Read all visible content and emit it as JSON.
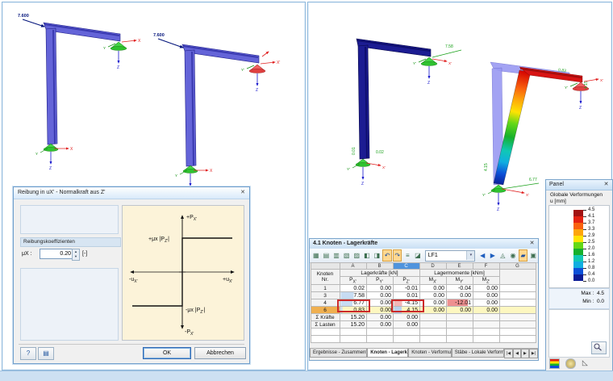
{
  "left_view": {
    "load1": "7.600",
    "load2": "7.600"
  },
  "axes": {
    "x": "X",
    "y": "Y",
    "z": "Z",
    "xp": "X'",
    "yp": "Y'"
  },
  "dialog": {
    "title": "Reibung in uX' - Normalkraft aus Z'",
    "close": "✕",
    "group": "Reibungskoeffizienten",
    "mu_label": "μX :",
    "mu_value": "0.20",
    "mu_unit": "[-]",
    "graph": {
      "top_m": "+P",
      "top_s": "X'",
      "bottom_m": "-P",
      "bottom_s": "X'",
      "right_m": "+u",
      "right_s": "X'",
      "left_m": "-u",
      "left_s": "X'",
      "pos_m": "+μx |P",
      "pos_s": "Z'",
      "pos_e": "|",
      "neg_m": "-μx |P",
      "neg_s": "Z'",
      "neg_e": "|"
    },
    "help": "?",
    "note_icon": "▤",
    "ok": "OK",
    "cancel": "Abbrechen"
  },
  "right_view": {
    "c_top_px": "7.58",
    "c_bot_px": "0.02",
    "c_bot_pz": "0.01",
    "d_top_px": "0.83",
    "d_top_pz": "4.15",
    "d_bot_px": "6.77",
    "d_bot_pz": "4.15"
  },
  "table": {
    "title": "4.1 Knoten - Lagerkräfte",
    "close": "✕",
    "toolbar": [
      {
        "name": "table-graphic-icon",
        "glyph": "▦"
      },
      {
        "name": "view-settings-icon",
        "glyph": "▤"
      },
      {
        "name": "row-filter-icon",
        "glyph": "▥"
      },
      {
        "name": "result-filter-icon",
        "glyph": "▧"
      },
      {
        "name": "selection-icon",
        "glyph": "▨"
      },
      {
        "name": "col-prev-icon",
        "glyph": "◧"
      },
      {
        "name": "col-next-icon",
        "glyph": "◨"
      },
      {
        "name": "undo-icon",
        "glyph": "↶"
      },
      {
        "name": "redo-icon",
        "glyph": "↷"
      },
      {
        "name": "sum-rows-icon",
        "glyph": "≡"
      },
      {
        "name": "result-diagram-icon",
        "glyph": "◪"
      }
    ],
    "loadcase": "LF1",
    "dd": "▾",
    "toolbar2": [
      {
        "name": "prev-case-icon",
        "glyph": "◀"
      },
      {
        "name": "next-case-icon",
        "glyph": "▶"
      },
      {
        "name": "filter-icon",
        "glyph": "◬"
      },
      {
        "name": "relations-icon",
        "glyph": "◉"
      },
      {
        "name": "color-ref-icon",
        "glyph": "▰"
      },
      {
        "name": "excel-export-icon",
        "glyph": "▣"
      }
    ],
    "letters": [
      "A",
      "B",
      "C",
      "D",
      "E",
      "F",
      "G"
    ],
    "hdr": {
      "node1": "Knoten",
      "node2": "Nr.",
      "forces": "Lagerkräfte [kN]",
      "moments": "Lagermomente [kNm]",
      "cols": [
        {
          "m": "P",
          "s": "X'"
        },
        {
          "m": "P",
          "s": "Y'"
        },
        {
          "m": "P",
          "s": "Z'"
        },
        {
          "m": "M",
          "s": "X'"
        },
        {
          "m": "M",
          "s": "Y'"
        },
        {
          "m": "M",
          "s": "Z'"
        }
      ]
    },
    "rows": [
      {
        "id": "1",
        "c": [
          "0.02",
          "0.00",
          "-0.01",
          "0.00",
          "-0.04",
          "0.00"
        ]
      },
      {
        "id": "3",
        "c": [
          "7.58",
          "0.00",
          "0.01",
          "0.00",
          "0.00",
          "0.00"
        ]
      },
      {
        "id": "4",
        "c": [
          "6.77",
          "0.00",
          "-4.15",
          "0.00",
          "-12.01",
          "0.00"
        ]
      },
      {
        "id": "6",
        "c": [
          "0.83",
          "0.00",
          "4.15",
          "0.00",
          "0.00",
          "0.00"
        ]
      },
      {
        "id": "Σ Kräfte",
        "c": [
          "15.20",
          "0.00",
          "0.00",
          "",
          "",
          ""
        ]
      },
      {
        "id": "Σ Lasten",
        "c": [
          "15.20",
          "0.00",
          "0.00",
          "",
          "",
          ""
        ]
      }
    ],
    "tabs": [
      {
        "label": "Ergebnisse - Zusammenfassung"
      },
      {
        "label": "Knoten - Lagerkräfte"
      },
      {
        "label": "Knoten - Verformungen"
      },
      {
        "label": "Stäbe - Lokale Verformungen"
      }
    ],
    "tab_nav": [
      "|◀",
      "◀",
      "▶",
      "▶|"
    ]
  },
  "panel": {
    "title": "Panel",
    "close": "✕",
    "caption1": "Globale Verformungen",
    "caption2": "u [mm]",
    "scale": [
      "4.5",
      "4.1",
      "3.7",
      "3.3",
      "2.9",
      "2.5",
      "2.0",
      "1.6",
      "1.2",
      "0.8",
      "0.4",
      "0.0"
    ],
    "colors": [
      "#A11212",
      "#E32112",
      "#F9610E",
      "#FDA50A",
      "#FFE303",
      "#64D816",
      "#16B02C",
      "#10C8B4",
      "#10AEE0",
      "#0C50D8",
      "#0C1C96"
    ],
    "max_label": "Max :",
    "max_value": "4.5",
    "min_label": "Min :",
    "min_value": "0.0"
  }
}
